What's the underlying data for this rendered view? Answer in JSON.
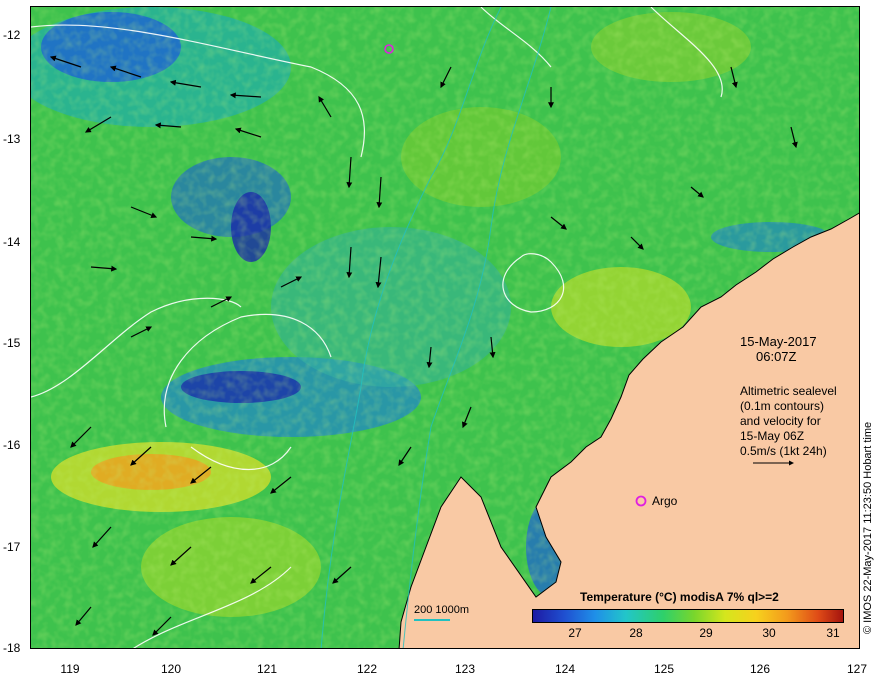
{
  "map": {
    "lon_range": [
      118.6,
      127
    ],
    "lat_range": [
      -18,
      -11.7
    ],
    "lon_ticks": [
      "119",
      "120",
      "121",
      "122",
      "123",
      "124",
      "125",
      "126",
      "127"
    ],
    "lat_ticks": [
      "-12",
      "-13",
      "-14",
      "-15",
      "-16",
      "-17",
      "-18"
    ],
    "date": "15-May-2017",
    "time": "06:07Z",
    "legend_lines": [
      "Altimetric sealevel",
      "(0.1m contours)",
      "and velocity for",
      "15-May 06Z",
      "0.5m/s (1kt 24h)"
    ],
    "argo_label": "Argo",
    "bathy_scale": "200  1000m",
    "colorbar_title": "Temperature (°C) modisA 7% ql>=2",
    "colorbar_ticks": [
      "27",
      "28",
      "29",
      "30",
      "31"
    ],
    "credit": "© IMOS 22-May-2017 11:23:50 Hobart time",
    "colors": {
      "land": "#f9c9a4",
      "sst_green": "#3ec24d",
      "sst_blue": "#1e5fd6",
      "contour_sealevel": "#ffffff",
      "contour_bathy": "#22c0c0",
      "argo_marker": "#e020e0"
    }
  }
}
